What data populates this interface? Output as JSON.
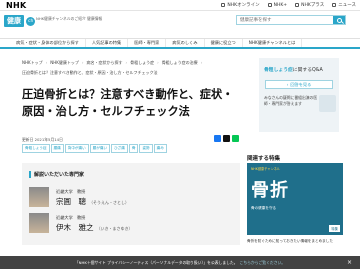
{
  "top": {
    "logo": "NHK",
    "links": [
      "NHKオンライン",
      "NHK+",
      "NHKプラス",
      "ニュース"
    ]
  },
  "header": {
    "kenko_label": "健康",
    "channel_label": "ch",
    "tagline": "NHK健康チャンネルのご紹介 健康情報",
    "search_placeholder": "健康記事を探す"
  },
  "nav": [
    "病気・症状・身体の部位から探す",
    "人気記事の特集",
    "医師・専門家",
    "病気のしくみ",
    "健康に役立つ",
    "NHK健康チャンネルとは"
  ],
  "breadcrumb1": [
    "NHKトップ",
    "NHK健康トップ",
    "病名・症状から探す",
    "骨粗しょう症",
    "骨粗しょう症の治療"
  ],
  "breadcrumb2": [
    "圧迫骨折とは？注意すべき動作と、症状・原因・治し方・セルフチェック法"
  ],
  "article": {
    "title": "圧迫骨折とは？注意すべき動作と、症状・原因・治し方・セルフチェック法",
    "date": "更新日 2021年5月14日",
    "tags": [
      "骨粗しょう症",
      "腰痛",
      "背中が痛い",
      "腰が痛い",
      "ひざ痛",
      "骨",
      "姿勢",
      "痛み"
    ]
  },
  "experts": {
    "title": "解説いただいた専門家",
    "list": [
      {
        "org": "近畿大学　教授",
        "name": "宗圓　聰",
        "kana": "（そうえん・さとし）"
      },
      {
        "org": "近畿大学　教授",
        "name": "伊木　雅之",
        "kana": "（いき・まさゆき）"
      }
    ]
  },
  "qa": {
    "title_prefix": "骨粗しょう症",
    "title_suffix": "に関するQ&A",
    "button": "回答を見る",
    "desc": "みなさんの疑問に番組出演の医師・専門家が答えます"
  },
  "related": {
    "heading": "関連する特集",
    "label": "NHK健康チャンネル",
    "big": "骨折",
    "sub": "骨の健康を守る",
    "badge": "特集",
    "caption": "骨折を防ぐために知っておきたい情報をまとめました"
  },
  "cookie": {
    "text": "「NHK＋個サイト プライバシーノーティス（パーソナルデータの取り扱い）」を公表しました。",
    "link": "こちらからご覧ください。",
    "close": "×"
  },
  "colors": {
    "accent": "#2aa6c9"
  }
}
